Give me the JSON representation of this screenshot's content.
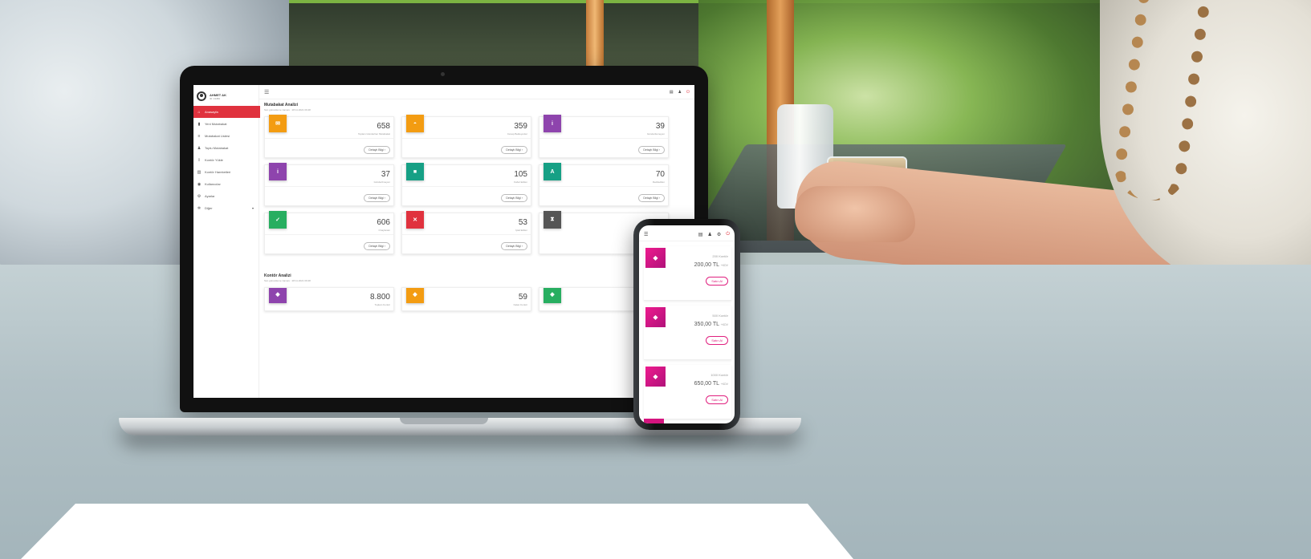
{
  "colors": {
    "brand_red": "#e0323e",
    "orange": "#f39c12",
    "purple": "#8e44ad",
    "teal": "#16a085",
    "green": "#27ae60",
    "red": "#e0323e",
    "gray": "#555555",
    "magenta": "#e0207f"
  },
  "sidebar": {
    "user_name": "AHMET AK",
    "user_role": "ID: 13450",
    "items": [
      {
        "label": "Anasayfa",
        "icon": "home-icon",
        "active": true
      },
      {
        "label": "Yeni Mutabakat",
        "icon": "document-icon"
      },
      {
        "label": "Mutabakat Listesi",
        "icon": "list-icon"
      },
      {
        "label": "Toplu Mutabakat",
        "icon": "users-icon"
      },
      {
        "label": "Kontör Yükle",
        "icon": "upload-icon"
      },
      {
        "label": "Kontör Hareketleri",
        "icon": "chart-icon"
      },
      {
        "label": "Kullanıcılar",
        "icon": "user-group-icon"
      },
      {
        "label": "Ayarlar",
        "icon": "settings-icon"
      },
      {
        "label": "Diğer",
        "icon": "gear-icon"
      }
    ]
  },
  "mutabakat": {
    "title": "Mutabakat Analizi",
    "subtitle": "Son güncelleme zamanı : 28.11.2021 09:48",
    "cards": [
      {
        "value": "658",
        "label": "Toplam Gönderilen Mutabakat",
        "icon": "email-icon",
        "color": "#f39c12"
      },
      {
        "value": "359",
        "label": "Cevap Bekleyenler",
        "icon": "chat-icon",
        "color": "#f39c12"
      },
      {
        "value": "39",
        "label": "Gönderilemeyen",
        "icon": "info-icon",
        "color": "#8e44ad"
      },
      {
        "value": "37",
        "label": "Gönderilmeyen",
        "icon": "info-icon",
        "color": "#8e44ad"
      },
      {
        "value": "105",
        "label": "Kabul Edilen",
        "icon": "square-icon",
        "color": "#16a085"
      },
      {
        "value": "70",
        "label": "Reddedilen",
        "icon": "a-icon",
        "color": "#16a085"
      },
      {
        "value": "606",
        "label": "Onaylanan",
        "icon": "check-icon",
        "color": "#27ae60"
      },
      {
        "value": "53",
        "label": "İptal Edilen",
        "icon": "close-icon",
        "color": "#e0323e"
      },
      {
        "value": "",
        "label": "",
        "icon": "hourglass-icon",
        "color": "#555555"
      }
    ],
    "button_label": "Detaylı Bilgi ›"
  },
  "kontor": {
    "title": "Kontör Analizi",
    "subtitle": "Son güncelleme zamanı : 28.11.2021 09:48",
    "cards": [
      {
        "value": "8.800",
        "label": "Toplam Kontör",
        "icon": "coin-icon",
        "color": "#8e44ad"
      },
      {
        "value": "59",
        "label": "Kalan Kontör",
        "icon": "coin-icon",
        "color": "#f39c12"
      },
      {
        "value": "",
        "label": "",
        "icon": "coin-icon",
        "color": "#27ae60"
      }
    ]
  },
  "phone": {
    "packages": [
      {
        "kontor": "200 Kontör",
        "price": "200,00 TL",
        "kdv": "+KDV",
        "button": "Satın Al"
      },
      {
        "kontor": "500 Kontör",
        "price": "350,00 TL",
        "kdv": "+KDV",
        "button": "Satın Al"
      },
      {
        "kontor": "1000 Kontör",
        "price": "650,00 TL",
        "kdv": "+KDV",
        "button": "Satın Al"
      }
    ]
  }
}
